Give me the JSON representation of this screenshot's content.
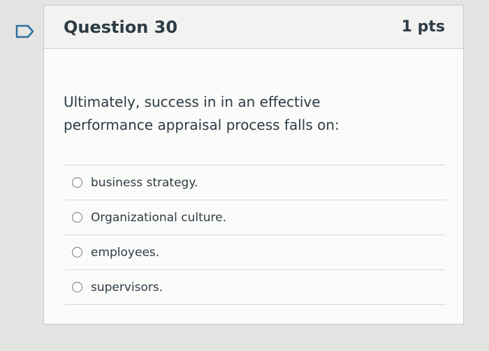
{
  "question": {
    "title": "Question 30",
    "points": "1 pts",
    "text": "Ultimately, success in in an effective performance appraisal process falls on:",
    "answers": [
      {
        "label": "business strategy."
      },
      {
        "label": "Organizational culture."
      },
      {
        "label": "employees."
      },
      {
        "label": "supervisors."
      }
    ]
  },
  "colors": {
    "flag_outline": "#2d6f9f",
    "text": "#2d3b45",
    "header_bg": "#f2f2f1"
  },
  "icons": {
    "flag": "flag-question-icon",
    "radio": "radio-unchecked-icon"
  }
}
